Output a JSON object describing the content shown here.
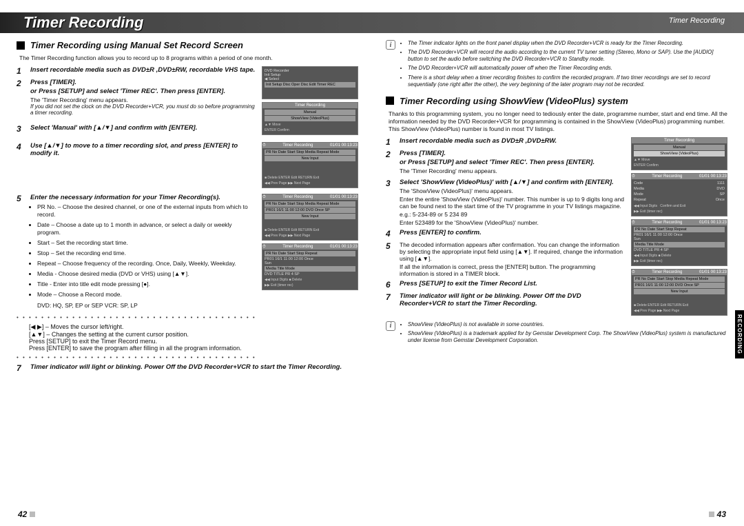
{
  "header": {
    "title_main": "Timer Recording",
    "title_side": "Timer Recording"
  },
  "left": {
    "section_title": "Timer Recording using Manual Set Record Screen",
    "intro": "The Timer Recording function allows you to record up to 8 programs within a period of one month.",
    "s1": "Insert recordable media such as DVD±R ,DVD±RW, recordable VHS tape.",
    "s2": "Press [TIMER].",
    "s2_or": "or Press [SETUP] and select 'Timer REC'. Then press [ENTER].",
    "s2_note": "The 'Timer Recording' menu appears.",
    "s2_it": "If you did not set the clock on the DVD Recorder+VCR, you must do so before programming a timer recording.",
    "s3": "Select 'Manual' with [▲/▼] and confirm with [ENTER].",
    "s4": "Use [▲/▼] to move to a timer recording slot, and press [ENTER] to modify it.",
    "s5": "Enter the necessary information for your Timer Recording(s).",
    "b5_1": "PR No. – Choose the desired channel, or one of the external inputs from which to record.",
    "b5_2": "Date – Choose a date up to 1 month in advance, or select a daily or weekly program.",
    "b5_3": "Start – Set the recording start time.",
    "b5_4": "Stop – Set the recording end time.",
    "b5_5": "Repeat – Choose frequency of the recording. Once, Daily, Weekly, Weekday.",
    "b5_6": "Media - Choose desired media (DVD or VHS) using [▲▼].",
    "b5_7": "Title - Enter into title edit mode pressing [●].",
    "b5_8": "Mode – Choose a Record mode.",
    "b5_extra": "DVD: HQ, SP, EP or SEP    VCR: SP, LP",
    "tips_1": "[◀ ▶] – Moves the cursor left/right.",
    "tips_2": "[▲▼] – Changes the setting at the current cursor position.",
    "tips_3": "Press [SETUP] to exit the Timer Record menu.",
    "tips_4": "Press [ENTER] to save the program after filling in all the program information.",
    "s7": "Timer indicator will light or blinking. Power Off the DVD Recorder+VCR to start the Timer Recording.",
    "page_num": "42"
  },
  "right": {
    "info1_1": "The Timer indicator lights on the front panel display when the DVD Recorder+VCR is ready for the Timer Recording.",
    "info1_2": "The DVD Recorder+VCR will record the audio according to the current TV tuner setting (Stereo, Mono or SAP). Use the [AUDIO] button to set the audio before switching the DVD Recorder+VCR to Standby mode.",
    "info1_3": "The DVD Recorder+VCR will automatically power off when the Timer Recording ends.",
    "info1_4": "There is a short delay when a timer recording finishes to confirm the recorded program. If two timer recordings are set to record sequentially (one right after the other), the very beginning of the later program may not be recorded.",
    "section_title": "Timer Recording using ShowView (VideoPlus) system",
    "intro": "Thanks to this programming system, you no longer need to tediously enter the date, programme number, start and end time. All the information needed by the DVD Recorder+VCR for programming is contained in the ShowView (VideoPlus) programming number. This ShowView (VideoPlus) number is found in most TV listings.",
    "s1": "Insert recordable media such as DVD±R ,DVD±RW.",
    "s2": "Press [TIMER].",
    "s2_or": "or Press [SETUP] and select 'Timer REC'. Then press [ENTER].",
    "s2_note": "The 'Timer Recording' menu appears.",
    "s3": "Select 'ShowView (VideoPlus)' with [▲/▼] and confirm with [ENTER].",
    "s3_note1": "The 'ShowView (VideoPlus)' menu appears.",
    "s3_note2": "Enter the entire 'ShowView (VideoPlus)' number. This number is up to 9 digits long and can be found next to the start time of the TV programme in your TV listings magazine.",
    "s3_note3": "e.g.: 5-234-89 or 5 234 89",
    "s3_note4": "Enter 523489 for the 'ShowView (VideoPlus)' number.",
    "s4": "Press [ENTER] to confirm.",
    "s5": "The decoded information appears after confirmation. You can change the information by selecting the appropriate input field using [▲▼]. If required, change the information using [▲▼].",
    "s5b": "If all the information is correct, press the [ENTER] button. The programming information is stored in a TIMER block.",
    "s6": "Press [SETUP] to exit the Timer Record List.",
    "s7": "Timer indicator will light or be blinking. Power Off the DVD Recorder+VCR to start the Timer Recording.",
    "info2_1": "ShowView (VideoPlus) is not available in some countries.",
    "info2_2": "ShowView (VideoPlus) is a trademark applied for by Gemstar Development Corp. The ShowView (VideoPlus) system is manufactured under license from Gemstar Development Corporation.",
    "page_num": "43",
    "side_tab": "RECORDING"
  },
  "shots": {
    "setup": {
      "hdr": "DVD Recorder",
      "l1": "Init Setup",
      "l2": "◀ Select",
      "tabs": "Init Setup   Disc Oper   Disc Edit   Timer REC"
    },
    "tr_menu": {
      "hdr": "Timer Recording",
      "r1": "Manual",
      "r2": "ShowView (VideoPlus)",
      "f1": "▲▼ Move",
      "f2": "ENTER Confirm"
    },
    "tr_list": {
      "hdr": "Timer Recording",
      "time": "01/01 00:13:23",
      "cols": "PR No  Date  Start  Stop  Media  Repeat  Mode",
      "row1": "New Input",
      "foot": "■ Delete   ENTER Edit   RETURN Exit",
      "foot2": "◀◀ Prev Page   ▶▶ Next Page"
    },
    "tr_list2": {
      "row1": "PR01   16/1   11:00   12:00   DVD   Once   SP"
    },
    "tr_edit": {
      "cols": "PR No   Date   Start   Stop   Repeat",
      "row": "PR01   16/1   11:00   12:00   Once",
      "wd": "Sun",
      "m": "Media          Title          Mode",
      "mv": "DVD         TITLE PR 4         SP",
      "foot": "◀◀ Input Digits   ■ Delete",
      "foot2": "▶▶ Exit (timer rec)"
    },
    "sv_entry": {
      "code": "Code",
      "code_v": "1111",
      "media": "Media",
      "media_v": "DVD",
      "mode": "Mode",
      "mode_v": "SP",
      "rep": "Repeat",
      "rep_v": "Once",
      "ext": "Confirm and Exit"
    }
  }
}
